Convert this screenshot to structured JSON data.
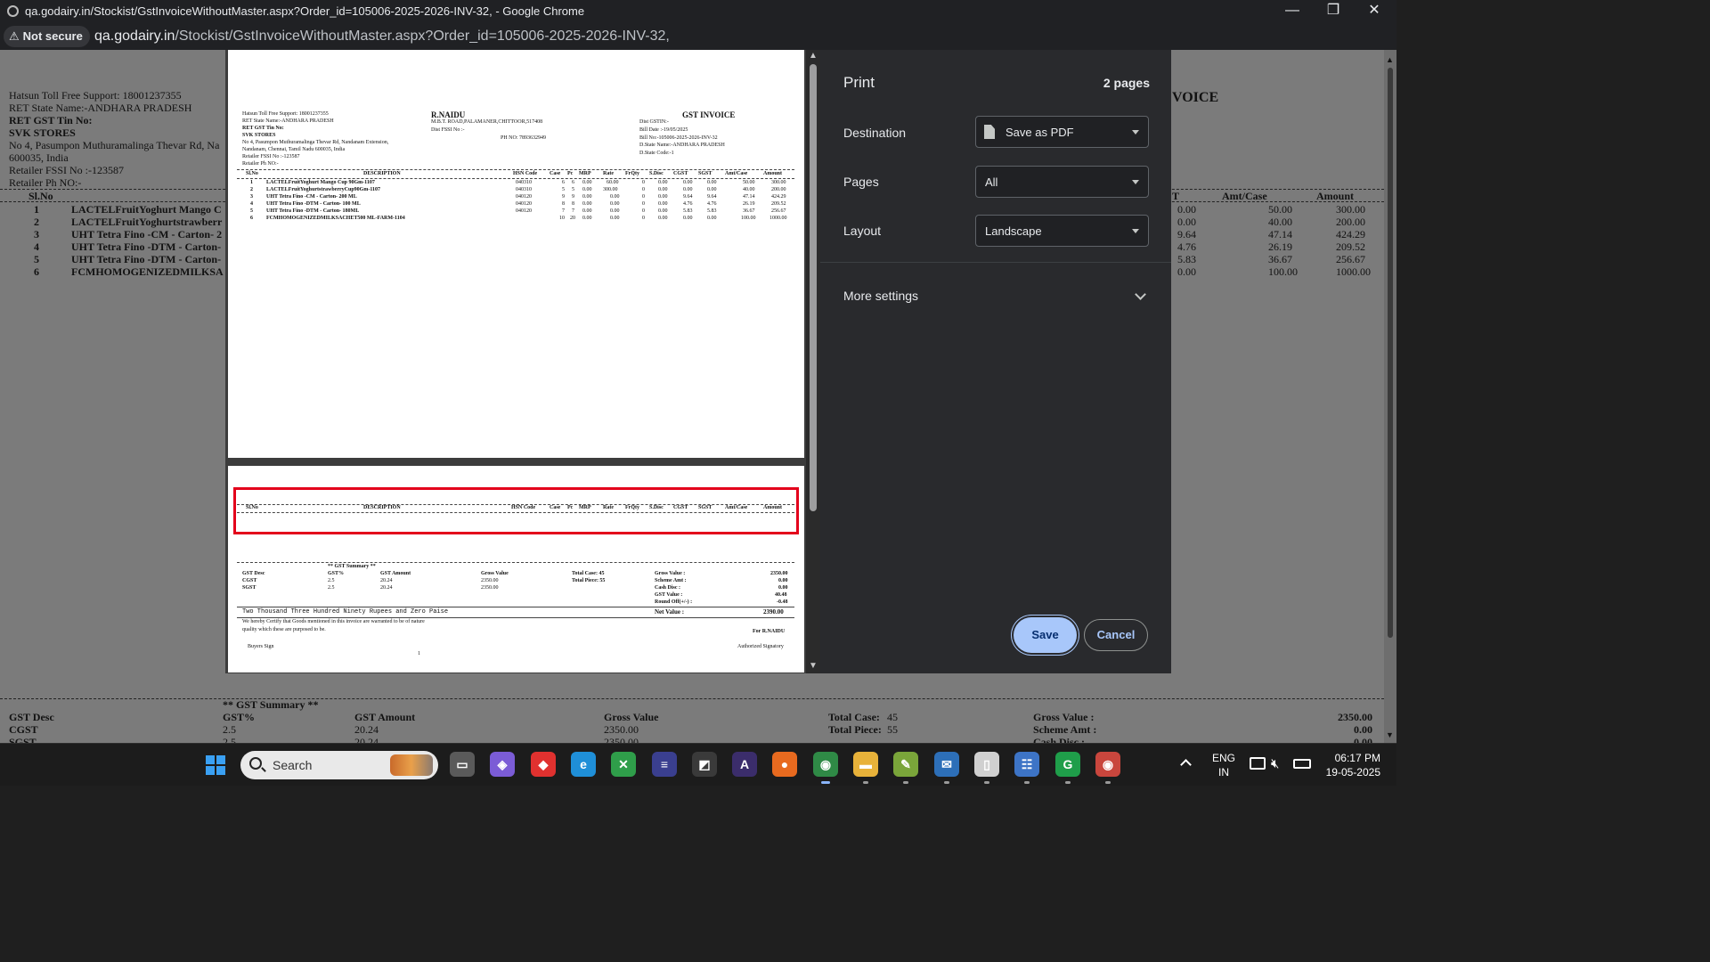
{
  "window": {
    "title": "qa.godairy.in/Stockist/GstInvoiceWithoutMaster.aspx?Order_id=105006-2025-2026-INV-32, - Google Chrome",
    "address_security": "Not secure",
    "address_host": "qa.godairy.in",
    "address_path": "/Stockist/GstInvoiceWithoutMaster.aspx?Order_id=105006-2025-2026-INV-32,",
    "minimize_glyph": "—",
    "restore_glyph": "❐",
    "close_glyph": "✕"
  },
  "background_page": {
    "support": "Hatsun Toll Free Support: 18001237355",
    "ret_state": "RET State Name:-ANDHARA PRADESH",
    "ret_gst": "RET GST Tin No:",
    "store": "SVK STORES",
    "address1": "No 4, Pasumpon Muthuramalinga Thevar Rd, Na",
    "address2": "600035, India",
    "fssi": "Retailer FSSI No :-123587",
    "phone": "Retailer Ph NO:-",
    "invoice_fragment": "VOICE",
    "col_slno": "Sl.No",
    "col_t": "T",
    "col_amt_case": "Amt/Case",
    "col_amount": "Amount",
    "rows": [
      {
        "no": "1",
        "desc": "LACTELFruitYoghurt Mango C",
        "sgst": "0.00",
        "amt_case": "50.00",
        "amount": "300.00"
      },
      {
        "no": "2",
        "desc": "LACTELFruitYoghurtstrawberr",
        "sgst": "0.00",
        "amt_case": "40.00",
        "amount": "200.00"
      },
      {
        "no": "3",
        "desc": "UHT Tetra Fino -CM - Carton- 2",
        "sgst": "9.64",
        "amt_case": "47.14",
        "amount": "424.29"
      },
      {
        "no": "4",
        "desc": "UHT Tetra Fino -DTM - Carton-",
        "sgst": "4.76",
        "amt_case": "26.19",
        "amount": "209.52"
      },
      {
        "no": "5",
        "desc": "UHT Tetra Fino -DTM - Carton-",
        "sgst": "5.83",
        "amt_case": "36.67",
        "amount": "256.67"
      },
      {
        "no": "6",
        "desc": "FCMHOMOGENIZEDMILKSA",
        "sgst": "0.00",
        "amt_case": "100.00",
        "amount": "1000.00"
      }
    ],
    "gst_summary_title": "** GST Summary **",
    "summary_row1": {
      "a": "GST Desc",
      "b": "GST%",
      "c": "GST Amount",
      "d": "Gross Value",
      "e": "Total Case:",
      "e2": "45",
      "f": "Gross Value :",
      "g": "2350.00"
    },
    "summary_row2": {
      "a": "CGST",
      "b": "2.5",
      "c": "20.24",
      "d": "2350.00",
      "e": "Total Piece:",
      "e2": "55",
      "f": "Scheme Amt :",
      "g": "0.00"
    },
    "summary_row3": {
      "a": "SGST",
      "b": "2.5",
      "c": "20.24",
      "d": "2350.00",
      "f": "Cash Disc :",
      "g": "0.00"
    }
  },
  "preview": {
    "page1": {
      "support": "Hatsun Toll Free Support: 18001237355",
      "ret_state": "RET State Name:-ANDHARA PRADESH",
      "ret_gst": "RET GST Tin No:",
      "store": "SVK STORES",
      "address1": "No 4, Pasumpon Muthuramalinga Thevar Rd, Nandanam Extension,",
      "address2": "Nandanam, Chennai, Tamil Nadu 600035, India",
      "fssi": "Retailer FSSI No :-123587",
      "phone": "Retailer Ph NO:-",
      "seller": "R.NAIDU",
      "seller_addr": "M.B.T. ROAD,PALAMANER,CHITTOOR,517408",
      "dist_fssi": "Dist FSSI No :-",
      "ph_no": "PH NO:  7893632949",
      "invoice_title": "GST INVOICE",
      "dist_gstin": "Dist GSTIN:-",
      "bill_date": "Bill Date :-19/05/2025",
      "bill_no": "Bill No:-105006-2025-2026-INV-32",
      "d_state": "D.State Name:-ANDHARA PRADESH",
      "d_code": "D.State Code:-1",
      "headers": [
        "Sl.No",
        "DESCRIPTION",
        "HSN Code",
        "Case",
        "Pc",
        "MRP",
        "Rate",
        "FrQty",
        "S.Disc",
        "CGST",
        "SGST",
        "Amt/Case",
        "Amount"
      ],
      "rows": [
        [
          "1",
          "LACTELFruitYoghurt Mango Cup 90Gm-1107",
          "040310",
          "6",
          "6",
          "0.00",
          "60.00",
          "0",
          "0.00",
          "0.00",
          "0.00",
          "50.00",
          "300.00"
        ],
        [
          "2",
          "LACTELFruitYoghurtstrawberryCup90Gm-1107",
          "040310",
          "5",
          "5",
          "0.00",
          "300.00",
          "0",
          "0.00",
          "0.00",
          "0.00",
          "40.00",
          "200.00"
        ],
        [
          "3",
          "UHT Tetra Fino -CM - Carton- 200 ML",
          "040120",
          "9",
          "9",
          "0.00",
          "0.00",
          "0",
          "0.00",
          "9.64",
          "9.64",
          "47.14",
          "424.29"
        ],
        [
          "4",
          "UHT Tetra Fino -DTM - Carton- 100 ML",
          "040120",
          "8",
          "8",
          "0.00",
          "0.00",
          "0",
          "0.00",
          "4.76",
          "4.76",
          "26.19",
          "209.52"
        ],
        [
          "5",
          "UHT Tetra Fino -DTM - Carton- 180ML",
          "040120",
          "7",
          "7",
          "0.00",
          "0.00",
          "0",
          "0.00",
          "5.83",
          "5.83",
          "36.67",
          "256.67"
        ],
        [
          "6",
          "FCMHOMOGENIZEDMILKSACHET500 ML-FARM-1104",
          "",
          "10",
          "20",
          "0.00",
          "0.00",
          "0",
          "0.00",
          "0.00",
          "0.00",
          "100.00",
          "1000.00"
        ]
      ]
    },
    "page2": {
      "headers": [
        "Sl.No",
        "DESCRIPTION",
        "HSN Code",
        "Case",
        "Pc",
        "MRP",
        "Rate",
        "FrQty",
        "S.Disc",
        "CGST",
        "SGST",
        "Amt/Case",
        "Amount"
      ],
      "gst_summary_title": "** GST Summary **",
      "gst_desc": "GST Desc",
      "gst_pct": "GST%",
      "gst_amount": "GST Amount",
      "gross_value": "Gross Value",
      "cgst": "CGST",
      "cgst_pct": "2.5",
      "cgst_amt": "20.24",
      "cgst_gross": "2350.00",
      "sgst": "SGST",
      "sgst_pct": "2.5",
      "sgst_amt": "20.24",
      "sgst_gross": "2350.00",
      "total_case": "Total Case:  45",
      "total_piece": "Total Piece:  55",
      "summary_labels": [
        "Gross Value :",
        "Scheme Amt :",
        "Cash Disc :",
        "GST Value :",
        "Round Off(+/-) :"
      ],
      "summary_values": [
        "2350.00",
        "0.00",
        "0.00",
        "40.48",
        "-0.48"
      ],
      "net_label": "Net Value  :",
      "net_value": "2390.00",
      "amount_words": "Two Thousand Three Hundred Ninety Rupees and Zero Paise",
      "certify1": "We hereby Certify that Goods mentioned in this invoice are warranted to be of nature",
      "certify2": "quality which these are purposed to be.",
      "for_seller": "For R.NAIDU",
      "buyers_sign": "Buyers Sign",
      "page_number": "1",
      "authorized": "Authorized Signatory"
    }
  },
  "print_panel": {
    "title": "Print",
    "page_count": "2 pages",
    "destination_label": "Destination",
    "destination_value": "Save as PDF",
    "pages_label": "Pages",
    "pages_value": "All",
    "layout_label": "Layout",
    "layout_value": "Landscape",
    "more_settings": "More settings",
    "save_label": "Save",
    "cancel_label": "Cancel"
  },
  "taskbar": {
    "search_placeholder": "Search",
    "lang_top": "ENG",
    "lang_bottom": "IN",
    "time": "06:17 PM",
    "date": "19-05-2025",
    "apps": [
      {
        "name": "task-view-icon",
        "glyph": "▭",
        "color": "#5a5a5a"
      },
      {
        "name": "copilot-icon",
        "glyph": "◈",
        "color": "#7b5cd6"
      },
      {
        "name": "anydesk-icon",
        "glyph": "◆",
        "color": "#e0312f"
      },
      {
        "name": "edge-icon",
        "glyph": "e",
        "color": "#1f8fd8"
      },
      {
        "name": "excel-tool-icon",
        "glyph": "✕",
        "color": "#2f9e4a"
      },
      {
        "name": "filezilla-icon",
        "glyph": "≡",
        "color": "#3a3f8f"
      },
      {
        "name": "notion-icon",
        "glyph": "◩",
        "color": "#3a3a3a"
      },
      {
        "name": "app-a-icon",
        "glyph": "A",
        "color": "#3b2d6b"
      },
      {
        "name": "firefox-icon",
        "glyph": "●",
        "color": "#e86a1f"
      },
      {
        "name": "chrome-icon",
        "glyph": "◉",
        "color": "#2f8a46"
      },
      {
        "name": "file-explorer-icon",
        "glyph": "▬",
        "color": "#e8b23a"
      },
      {
        "name": "notepad-plus-icon",
        "glyph": "✎",
        "color": "#7aa53a"
      },
      {
        "name": "mail-icon",
        "glyph": "✉",
        "color": "#2d6fb8"
      },
      {
        "name": "document-icon",
        "glyph": "▯",
        "color": "#d0d0d0"
      },
      {
        "name": "chat-icon",
        "glyph": "☷",
        "color": "#3d74c6"
      },
      {
        "name": "greenshot-icon",
        "glyph": "G",
        "color": "#1f9e4a"
      },
      {
        "name": "chrome-profile-icon",
        "glyph": "◉",
        "color": "#c9463d"
      }
    ]
  }
}
